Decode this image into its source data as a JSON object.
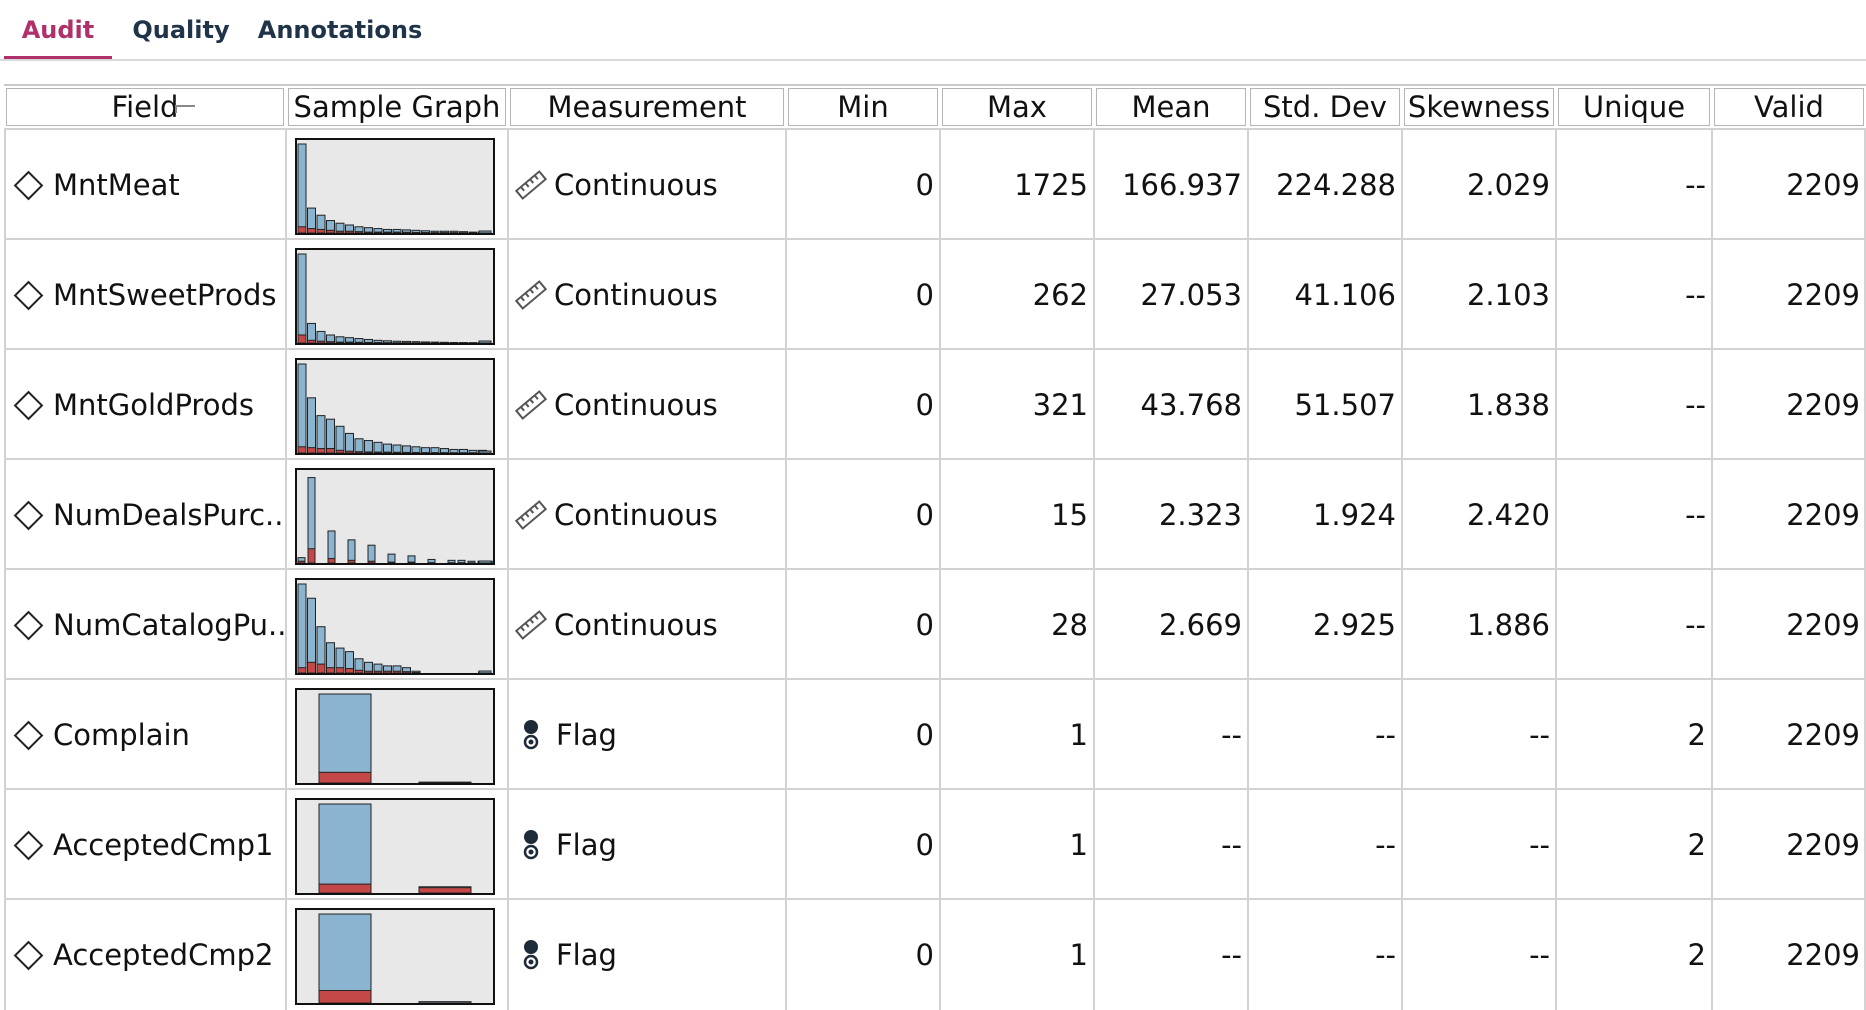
{
  "tabs": [
    {
      "label": "Audit",
      "active": true
    },
    {
      "label": "Quality",
      "active": false
    },
    {
      "label": "Annotations",
      "active": false
    }
  ],
  "columns": [
    "Field",
    "Sample Graph",
    "Measurement",
    "Min",
    "Max",
    "Mean",
    "Std. Dev",
    "Skewness",
    "Unique",
    "Valid"
  ],
  "colors": {
    "active_tab": "#b0306a",
    "bar_blue": "#8ab4cf",
    "bar_red": "#c44848",
    "graph_bg": "#e8e8e8"
  },
  "rows": [
    {
      "field": "MntMeat",
      "measurement": "Continuous",
      "measurement_icon": "ruler-icon",
      "min": "0",
      "max": "1725",
      "mean": "166.937",
      "std_dev": "224.288",
      "skewness": "2.029",
      "unique": "--",
      "valid": "2209",
      "graph": {
        "type": "histogram",
        "bins": [
          1.0,
          0.28,
          0.2,
          0.14,
          0.11,
          0.09,
          0.07,
          0.06,
          0.05,
          0.04,
          0.04,
          0.035,
          0.03,
          0.025,
          0.02,
          0.02,
          0.02,
          0.015,
          0.01,
          0.01
        ],
        "red": [
          0.07,
          0.05,
          0.04,
          0.03,
          0.02,
          0.02,
          0.015,
          0.01,
          0.01,
          0.01,
          0.01,
          0.008,
          0.006,
          0.005,
          0.004,
          0.004,
          0.004,
          0.003,
          0.002,
          0.002
        ]
      }
    },
    {
      "field": "MntSweetProds",
      "measurement": "Continuous",
      "measurement_icon": "ruler-icon",
      "min": "0",
      "max": "262",
      "mean": "27.053",
      "std_dev": "41.106",
      "skewness": "2.103",
      "unique": "--",
      "valid": "2209",
      "graph": {
        "type": "histogram",
        "bins": [
          1.0,
          0.22,
          0.13,
          0.09,
          0.07,
          0.06,
          0.05,
          0.04,
          0.03,
          0.025,
          0.02,
          0.018,
          0.015,
          0.012,
          0.01,
          0.008,
          0.006,
          0.005,
          0.004,
          0.003
        ],
        "red": [
          0.09,
          0.03,
          0.02,
          0.015,
          0.01,
          0.01,
          0.008,
          0.006,
          0.005,
          0.004,
          0.003,
          0.003,
          0.002,
          0.002,
          0.002,
          0.001,
          0.001,
          0.001,
          0.001,
          0.001
        ]
      }
    },
    {
      "field": "MntGoldProds",
      "measurement": "Continuous",
      "measurement_icon": "ruler-icon",
      "min": "0",
      "max": "321",
      "mean": "43.768",
      "std_dev": "51.507",
      "skewness": "1.838",
      "unique": "--",
      "valid": "2209",
      "graph": {
        "type": "histogram",
        "bins": [
          1.0,
          0.62,
          0.42,
          0.38,
          0.3,
          0.22,
          0.16,
          0.14,
          0.12,
          0.1,
          0.09,
          0.08,
          0.07,
          0.06,
          0.06,
          0.05,
          0.04,
          0.04,
          0.03,
          0.03
        ],
        "red": [
          0.07,
          0.06,
          0.05,
          0.05,
          0.03,
          0.02,
          0.015,
          0.012,
          0.01,
          0.01,
          0.008,
          0.007,
          0.006,
          0.005,
          0.005,
          0.004,
          0.003,
          0.003,
          0.003,
          0.002
        ]
      }
    },
    {
      "field": "NumDealsPurc...",
      "measurement": "Continuous",
      "measurement_icon": "ruler-icon",
      "min": "0",
      "max": "15",
      "mean": "2.323",
      "std_dev": "1.924",
      "skewness": "2.420",
      "unique": "--",
      "valid": "2209",
      "graph": {
        "type": "bars-gapped",
        "bins": [
          0.06,
          0.96,
          0,
          0.36,
          0,
          0.26,
          0,
          0.2,
          0,
          0.1,
          0,
          0.08,
          0,
          0.04,
          0,
          0.03,
          0.03,
          0.02,
          0.02,
          0.02
        ],
        "red": [
          0.02,
          0.16,
          0,
          0.05,
          0,
          0.03,
          0,
          0.02,
          0,
          0.01,
          0,
          0.01,
          0,
          0.004,
          0,
          0.003,
          0.003,
          0.002,
          0.002,
          0.002
        ]
      }
    },
    {
      "field": "NumCatalogPu...",
      "measurement": "Continuous",
      "measurement_icon": "ruler-icon",
      "min": "0",
      "max": "28",
      "mean": "2.669",
      "std_dev": "2.925",
      "skewness": "1.886",
      "unique": "--",
      "valid": "2209",
      "graph": {
        "type": "histogram",
        "bins": [
          1.0,
          0.84,
          0.52,
          0.34,
          0.28,
          0.24,
          0.16,
          0.12,
          0.1,
          0.08,
          0.08,
          0.06,
          0.02,
          0.0,
          0,
          0,
          0,
          0,
          0,
          0.01
        ],
        "red": [
          0.06,
          0.12,
          0.1,
          0.06,
          0.06,
          0.05,
          0.03,
          0.02,
          0.02,
          0.02,
          0.02,
          0.015,
          0.005,
          0,
          0,
          0,
          0,
          0,
          0,
          0.002
        ]
      }
    },
    {
      "field": "Complain",
      "measurement": "Flag",
      "measurement_icon": "flag-icon",
      "min": "0",
      "max": "1",
      "mean": "--",
      "std_dev": "--",
      "skewness": "--",
      "unique": "2",
      "valid": "2209",
      "graph": {
        "type": "flag",
        "values": [
          1.0,
          0.01
        ],
        "red": [
          0.12,
          0.0
        ]
      }
    },
    {
      "field": "AcceptedCmp1",
      "measurement": "Flag",
      "measurement_icon": "flag-icon",
      "min": "0",
      "max": "1",
      "mean": "--",
      "std_dev": "--",
      "skewness": "--",
      "unique": "2",
      "valid": "2209",
      "graph": {
        "type": "flag",
        "values": [
          1.0,
          0.07
        ],
        "red": [
          0.1,
          0.06
        ]
      }
    },
    {
      "field": "AcceptedCmp2",
      "measurement": "Flag",
      "measurement_icon": "flag-icon",
      "min": "0",
      "max": "1",
      "mean": "--",
      "std_dev": "--",
      "skewness": "--",
      "unique": "2",
      "valid": "2209",
      "graph": {
        "type": "flag",
        "values": [
          1.0,
          0.015
        ],
        "red": [
          0.14,
          0.0
        ]
      }
    }
  ]
}
